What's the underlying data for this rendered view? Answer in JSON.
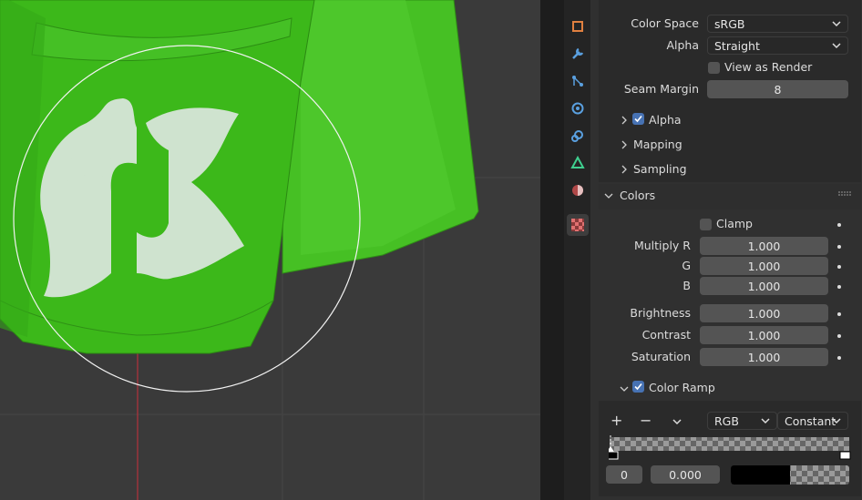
{
  "image_settings": {
    "color_space_label": "Color Space",
    "color_space_value": "sRGB",
    "alpha_label": "Alpha",
    "alpha_value": "Straight",
    "view_as_render_label": "View as Render",
    "view_as_render_checked": false,
    "seam_margin_label": "Seam Margin",
    "seam_margin_value": "8"
  },
  "subpanels": {
    "alpha_label": "Alpha",
    "alpha_checked": true,
    "mapping_label": "Mapping",
    "sampling_label": "Sampling"
  },
  "colors": {
    "title": "Colors",
    "clamp_label": "Clamp",
    "clamp_checked": false,
    "multiply_r_label": "Multiply R",
    "multiply_r_value": "1.000",
    "g_label": "G",
    "g_value": "1.000",
    "b_label": "B",
    "b_value": "1.000",
    "brightness_label": "Brightness",
    "brightness_value": "1.000",
    "contrast_label": "Contrast",
    "contrast_value": "1.000",
    "saturation_label": "Saturation",
    "saturation_value": "1.000"
  },
  "color_ramp": {
    "label": "Color Ramp",
    "checked": true,
    "add_label": "+",
    "remove_label": "−",
    "color_mode": "RGB",
    "interpolation": "Constant",
    "stop_index": "0",
    "stop_position": "0.000"
  },
  "property_tabs": [
    "texture-paint-icon",
    "wrench-icon",
    "particles-icon",
    "physics-icon",
    "constraints-icon",
    "data-icon",
    "material-icon",
    "texture-icon"
  ],
  "colors_theme": {
    "accent": "#4772b3",
    "mesh_green": "#35b515",
    "decal": "#cfe3cf"
  }
}
